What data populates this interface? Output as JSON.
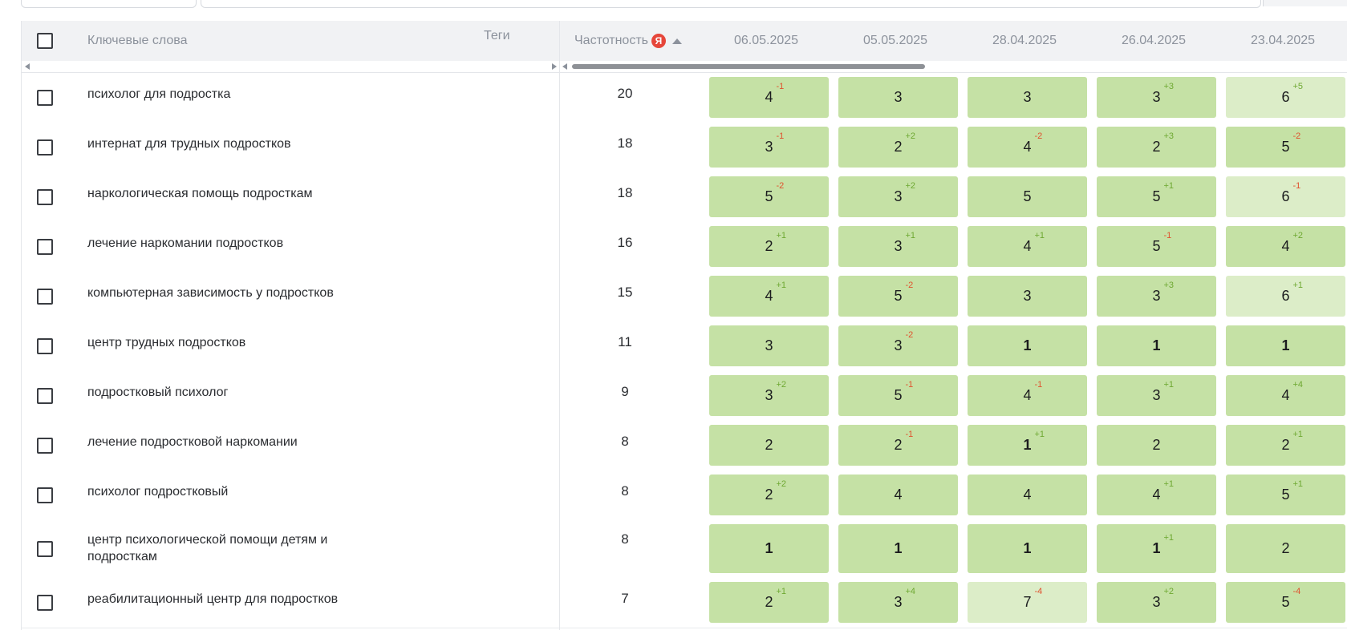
{
  "header": {
    "keywords_label": "Ключевые слова",
    "tags_label": "Теги",
    "frequency_label": "Частотность",
    "yandex_glyph": "Я",
    "dates": [
      "06.05.2025",
      "05.05.2025",
      "28.04.2025",
      "26.04.2025",
      "23.04.2025"
    ]
  },
  "colors": {
    "cell_green": "#c5e1a5",
    "cell_light_green": "#dcedc8",
    "delta_negative": "#e0512e",
    "delta_positive": "#6ea832",
    "yandex_badge": "#e6463a"
  },
  "rows": [
    {
      "keyword": "психолог для подростка",
      "frequency": "20",
      "cells": [
        {
          "v": "4",
          "d": "-1"
        },
        {
          "v": "3",
          "d": ""
        },
        {
          "v": "3",
          "d": ""
        },
        {
          "v": "3",
          "d": "+3"
        },
        {
          "v": "6",
          "d": "+5",
          "light": true
        }
      ]
    },
    {
      "keyword": "интернат для трудных подростков",
      "frequency": "18",
      "cells": [
        {
          "v": "3",
          "d": "-1"
        },
        {
          "v": "2",
          "d": "+2"
        },
        {
          "v": "4",
          "d": "-2"
        },
        {
          "v": "2",
          "d": "+3"
        },
        {
          "v": "5",
          "d": "-2"
        }
      ]
    },
    {
      "keyword": "наркологическая помощь подросткам",
      "frequency": "18",
      "cells": [
        {
          "v": "5",
          "d": "-2"
        },
        {
          "v": "3",
          "d": "+2"
        },
        {
          "v": "5",
          "d": ""
        },
        {
          "v": "5",
          "d": "+1"
        },
        {
          "v": "6",
          "d": "-1",
          "light": true
        }
      ]
    },
    {
      "keyword": "лечение наркомании подростков",
      "frequency": "16",
      "cells": [
        {
          "v": "2",
          "d": "+1"
        },
        {
          "v": "3",
          "d": "+1"
        },
        {
          "v": "4",
          "d": "+1"
        },
        {
          "v": "5",
          "d": "-1"
        },
        {
          "v": "4",
          "d": "+2"
        }
      ]
    },
    {
      "keyword": "компьютерная зависимость у подростков",
      "frequency": "15",
      "cells": [
        {
          "v": "4",
          "d": "+1"
        },
        {
          "v": "5",
          "d": "-2"
        },
        {
          "v": "3",
          "d": ""
        },
        {
          "v": "3",
          "d": "+3"
        },
        {
          "v": "6",
          "d": "+1",
          "light": true
        }
      ]
    },
    {
      "keyword": "центр трудных подростков",
      "frequency": "11",
      "cells": [
        {
          "v": "3",
          "d": ""
        },
        {
          "v": "3",
          "d": "-2"
        },
        {
          "v": "1",
          "d": "",
          "bold": true
        },
        {
          "v": "1",
          "d": "",
          "bold": true
        },
        {
          "v": "1",
          "d": "",
          "bold": true
        }
      ]
    },
    {
      "keyword": "подростковый психолог",
      "frequency": "9",
      "cells": [
        {
          "v": "3",
          "d": "+2"
        },
        {
          "v": "5",
          "d": "-1"
        },
        {
          "v": "4",
          "d": "-1"
        },
        {
          "v": "3",
          "d": "+1"
        },
        {
          "v": "4",
          "d": "+4"
        }
      ]
    },
    {
      "keyword": "лечение подростковой наркомании",
      "frequency": "8",
      "cells": [
        {
          "v": "2",
          "d": ""
        },
        {
          "v": "2",
          "d": "-1"
        },
        {
          "v": "1",
          "d": "+1",
          "bold": true
        },
        {
          "v": "2",
          "d": ""
        },
        {
          "v": "2",
          "d": "+1"
        }
      ]
    },
    {
      "keyword": "психолог подростковый",
      "frequency": "8",
      "cells": [
        {
          "v": "2",
          "d": "+2"
        },
        {
          "v": "4",
          "d": ""
        },
        {
          "v": "4",
          "d": ""
        },
        {
          "v": "4",
          "d": "+1"
        },
        {
          "v": "5",
          "d": "+1"
        }
      ]
    },
    {
      "keyword": "центр психологической помощи детям и подросткам",
      "frequency": "8",
      "tall": true,
      "cells": [
        {
          "v": "1",
          "d": "",
          "bold": true
        },
        {
          "v": "1",
          "d": "",
          "bold": true
        },
        {
          "v": "1",
          "d": "",
          "bold": true
        },
        {
          "v": "1",
          "d": "+1",
          "bold": true
        },
        {
          "v": "2",
          "d": ""
        }
      ]
    },
    {
      "keyword": "реабилитационный центр для подростков",
      "frequency": "7",
      "cells": [
        {
          "v": "2",
          "d": "+1"
        },
        {
          "v": "3",
          "d": "+4"
        },
        {
          "v": "7",
          "d": "-4",
          "light": true
        },
        {
          "v": "3",
          "d": "+2"
        },
        {
          "v": "5",
          "d": "-4"
        }
      ]
    }
  ]
}
